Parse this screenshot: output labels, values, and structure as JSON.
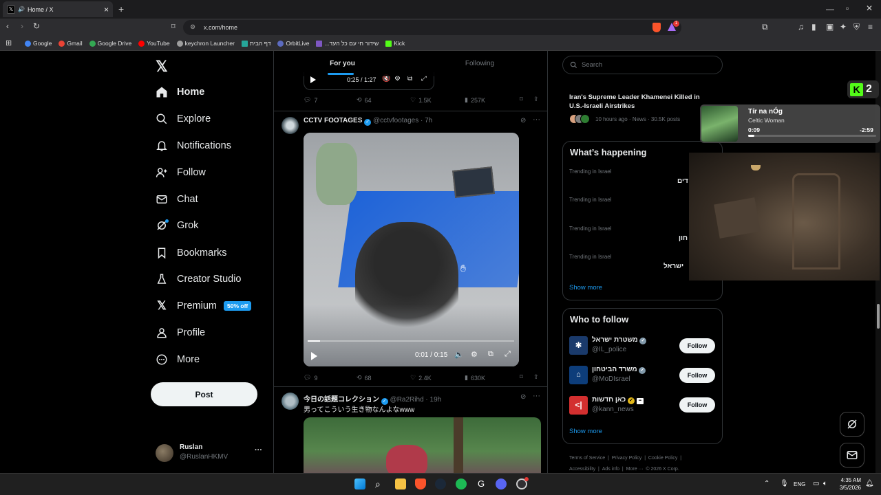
{
  "browser": {
    "tab_title": "Home / X",
    "tab_close": "×",
    "new_tab": "+",
    "url": "x.com/home",
    "bookmarks": [
      {
        "label": "Google",
        "color": "#4285f4"
      },
      {
        "label": "Gmail",
        "color": "#ea4335"
      },
      {
        "label": "Google Drive",
        "color": "#34a853"
      },
      {
        "label": "YouTube",
        "color": "#ff0000"
      },
      {
        "label": "keychron Launcher",
        "color": "#9e9e9e"
      },
      {
        "label": "דף הבית",
        "color": "#26a69a"
      },
      {
        "label": "OrbitLive",
        "color": "#5c6bc0"
      },
      {
        "label": "...שידור חי עם כל העד",
        "color": "#7e57c2"
      },
      {
        "label": "Kick",
        "color": "#53fc18"
      }
    ],
    "brave_badge": "1"
  },
  "nav": {
    "items": [
      {
        "label": "Home",
        "icon": "home-icon"
      },
      {
        "label": "Explore",
        "icon": "search-icon"
      },
      {
        "label": "Notifications",
        "icon": "bell-icon"
      },
      {
        "label": "Follow",
        "icon": "person-add-icon"
      },
      {
        "label": "Chat",
        "icon": "mail-icon"
      },
      {
        "label": "Grok",
        "icon": "grok-icon"
      },
      {
        "label": "Bookmarks",
        "icon": "bookmark-icon"
      },
      {
        "label": "Creator Studio",
        "icon": "flask-icon"
      },
      {
        "label": "Premium",
        "icon": "x-icon"
      },
      {
        "label": "Profile",
        "icon": "user-icon"
      },
      {
        "label": "More",
        "icon": "more-circle-icon"
      }
    ],
    "premium_badge": "50% off",
    "post_button": "Post",
    "account": {
      "name": "Ruslan",
      "handle": "@RuslanHKMV",
      "menu": "···"
    }
  },
  "feed": {
    "tabs": [
      "For you",
      "Following"
    ],
    "prev_post": {
      "time": "0:25 / 1:27",
      "replies": "7",
      "reposts": "64",
      "likes": "1.5K",
      "views": "257K"
    },
    "post1": {
      "name": "CCTV FOOTAGES",
      "handle": "@cctvfootages",
      "age": "· 7h",
      "video_time": "0:01 / 0:15",
      "video_progress": 0.06,
      "replies": "9",
      "reposts": "68",
      "likes": "2.4K",
      "views": "630K"
    },
    "post2": {
      "name": "今日の話題コレクション",
      "handle": "@Ra2Rihd",
      "age": "· 19h",
      "text": "男ってこういう生き物なんよなwww"
    }
  },
  "sidebar": {
    "search_placeholder": "Search",
    "news": {
      "title": "Iran's Supreme Leader Khamenei Killed in U.S.-Israeli Airstrikes",
      "meta": "10 hours ago · News · 30.5K posts"
    },
    "happening_title": "What’s happening",
    "trends": [
      {
        "context": "Trending in Israel",
        "name": "דים"
      },
      {
        "context": "Trending in Israel",
        "name": ""
      },
      {
        "context": "Trending in Israel",
        "name": "חון"
      },
      {
        "context": "Trending in Israel",
        "name": "ישראל"
      }
    ],
    "show_more": "Show more",
    "who_title": "Who to follow",
    "who": [
      {
        "name": "משטרת ישראל",
        "handle": "@IL_police",
        "follow": "Follow"
      },
      {
        "name": "משרד הביטחון",
        "handle": "@MoDIsrael",
        "follow": "Follow"
      },
      {
        "name": "כאן חדשות",
        "handle": "@kann_news",
        "follow": "Follow"
      }
    ],
    "show_more2": "Show more",
    "footer": [
      "Terms of Service",
      "|",
      "Privacy Policy",
      "|",
      "Cookie Policy",
      "|",
      "Accessibility",
      "|",
      "Ads info",
      "|",
      "More ···",
      "© 2026 X Corp."
    ]
  },
  "overlay": {
    "kick_count": "2",
    "song_title": "Tír na nÓg",
    "artist": "Celtic Woman",
    "elapsed": "0:09",
    "remaining": "-2:59",
    "progress": 0.05
  },
  "taskbar": {
    "lang": "ENG",
    "time": "4:35 AM",
    "date": "3/5/2026"
  },
  "colors": {
    "accent": "#1d9bf0",
    "kick": "#53fc18",
    "gold": "#e2b719"
  }
}
